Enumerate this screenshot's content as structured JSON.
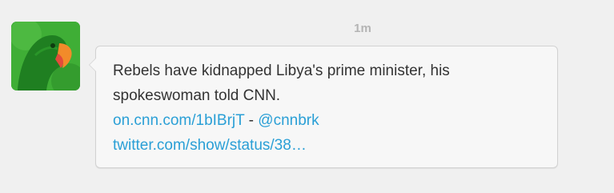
{
  "timestamp": "1m",
  "avatar": {
    "icon": "parrot-avatar-icon",
    "colors": {
      "background": "#3fae36",
      "bird": "#1f7f21",
      "beak_top": "#f28b2a",
      "beak_bottom": "#e34b3b"
    }
  },
  "tweet": {
    "text_line_1": "Rebels have kidnapped Libya's prime minister, his",
    "text_line_2": "spokeswoman told CNN.",
    "short_link": "on.cnn.com/1bIBrjT",
    "separator": " - ",
    "mention": "@cnnbrk",
    "status_link": "twitter.com/show/status/38…"
  },
  "colors": {
    "page_bg": "#f0f0f0",
    "bubble_bg": "#f7f7f7",
    "bubble_border": "#d2d2d2",
    "text": "#333333",
    "link": "#2a9fd6",
    "timestamp": "#b4b4b4"
  }
}
